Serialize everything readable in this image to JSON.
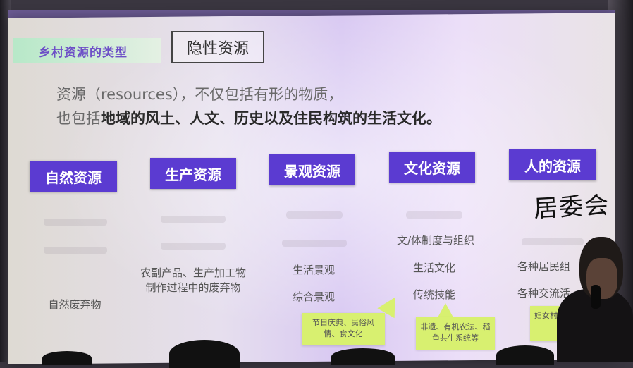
{
  "section_title": "乡村资源的类型",
  "subtype_label": "隐性资源",
  "definition": {
    "line1": "资源（resources），不仅包括有形的物质，",
    "line2_prefix": "也包括",
    "line2_bold": "地域的风土、人文、历史以及住民构筑的生活文化。"
  },
  "categories": [
    {
      "label": "自然资源",
      "items": [
        "自然废弃物"
      ]
    },
    {
      "label": "生产资源",
      "items": [
        "农副产品、生产加工物制作过程中的废弃物"
      ]
    },
    {
      "label": "景观资源",
      "items": [
        "生活景观",
        "综合景观"
      ]
    },
    {
      "label": "文化资源",
      "items": [
        "文/体制度与组织",
        "生活文化",
        "传统技能"
      ]
    },
    {
      "label": "人的资源",
      "items": [
        "各种居民组",
        "各种交流活"
      ]
    }
  ],
  "notes": [
    {
      "text": "节日庆典、民俗风情、食文化"
    },
    {
      "text": "非遗、有机农法、稻鱼共生系统等"
    },
    {
      "text": "妇女村"
    }
  ],
  "handwritten_note": "居委会",
  "colors": {
    "category_fill": "#5b3bd1",
    "section_title": "#6d4fc7",
    "note_fill": "#d8f070",
    "banner_fill": "#b7e8c8"
  }
}
